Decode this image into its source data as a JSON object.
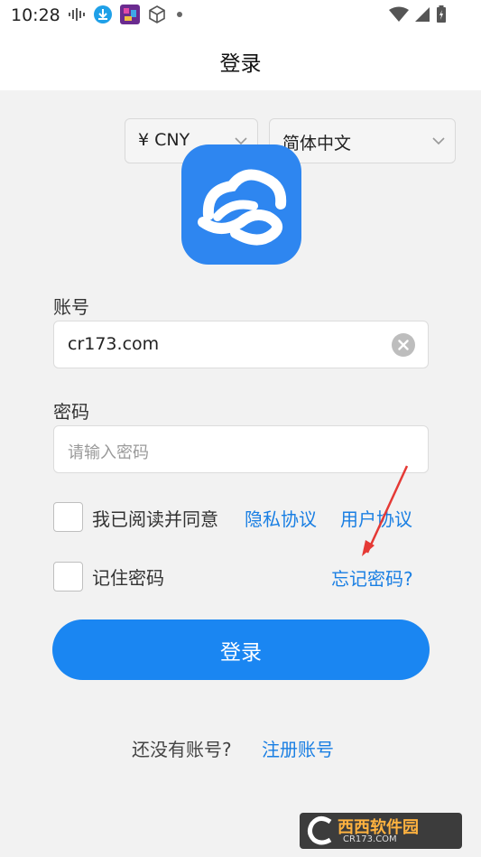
{
  "status_bar": {
    "time": "10:28"
  },
  "header": {
    "title": "登录"
  },
  "selectors": {
    "currency": "¥ CNY",
    "language": "简体中文"
  },
  "form": {
    "account_label": "账号",
    "account_value": "cr173.com",
    "password_label": "密码",
    "password_placeholder": "请输入密码",
    "agree_text": "我已阅读并同意",
    "privacy_link": "隐私协议",
    "user_agreement_link": "用户协议",
    "remember_label": "记住密码",
    "forgot_link": "忘记密码?",
    "login_button": "登录"
  },
  "footer": {
    "no_account_text": "还没有账号?",
    "register_link": "注册账号"
  },
  "watermark": {
    "brand": "西西软件园",
    "url": "CR173.COM"
  },
  "colors": {
    "accent": "#1a86f2",
    "link": "#1a7fe3",
    "logo_bg": "#2e86f0",
    "annotation_arrow": "#e53935",
    "background": "#f2f2f2"
  }
}
